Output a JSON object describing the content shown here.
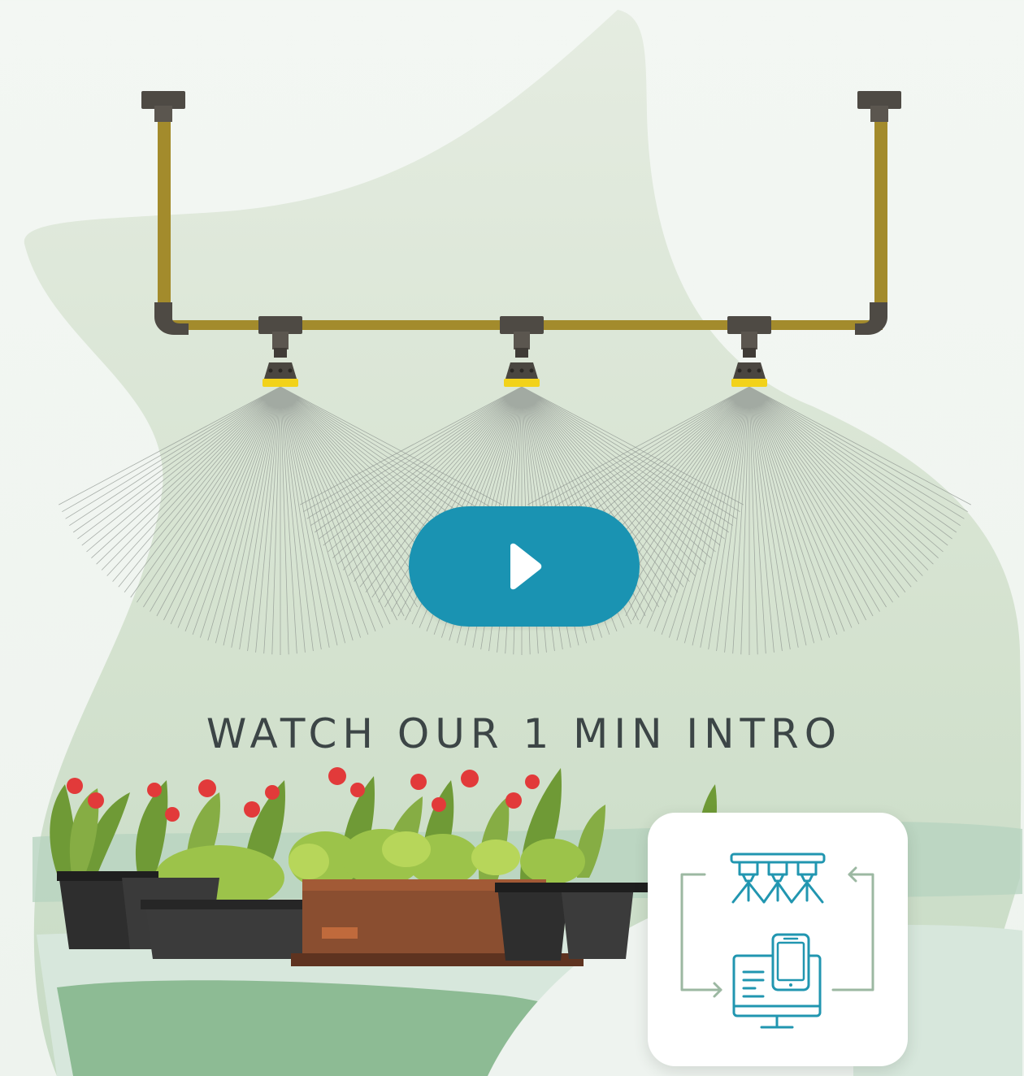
{
  "intro": {
    "title": "WATCH OUR 1 MIN INTRO",
    "play_button_label": "Play video"
  },
  "colors": {
    "accent": "#1a93b2",
    "pipe": "#a38b2c",
    "fitting": "#4e4a44",
    "nozzle_ring": "#f2d21a",
    "blob_light": "#e2ebde",
    "blob_mid": "#cfe0cb",
    "ground": "#aacfb8",
    "text": "#3c4546",
    "card_icon": "#2196b0",
    "card_arrow": "#9cb8a2"
  },
  "icons": {
    "play": "play-icon",
    "sprinkler": "sprinkler-system-icon",
    "devices": "computer-phone-icon",
    "cycle": "cycle-arrows-icon"
  }
}
